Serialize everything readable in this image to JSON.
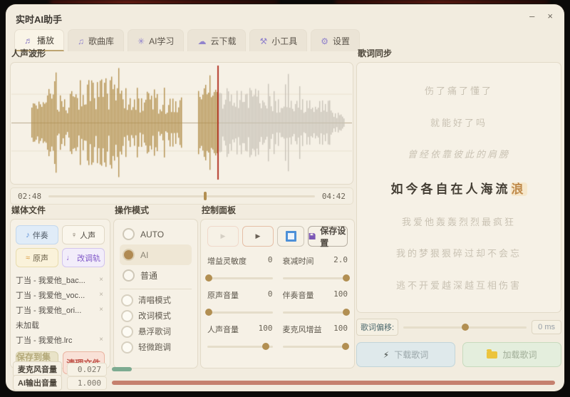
{
  "window": {
    "title": "实时AI助手",
    "minimize_label": "–",
    "close_label": "×"
  },
  "icons": {
    "piano": "♬",
    "music_notes": "♫",
    "ai": "✳",
    "cloud": "☁",
    "tools": "⚒",
    "gear": "⚙",
    "note": "♪",
    "person": "♀",
    "wave": "≈",
    "pitch": "♩",
    "play": "▶",
    "lightning": "⚡",
    "remove": "×"
  },
  "tabs": {
    "items": [
      {
        "label": "播放",
        "active": true
      },
      {
        "label": "歌曲库",
        "active": false
      },
      {
        "label": "AI学习",
        "active": false
      },
      {
        "label": "云下载",
        "active": false
      },
      {
        "label": "小工具",
        "active": false
      },
      {
        "label": "设置",
        "active": false
      }
    ]
  },
  "waveform": {
    "title": "人声波形",
    "current_time": "02:48",
    "total_time": "04:42",
    "progress_percent": 59.6,
    "cursor_percent": 60.5,
    "played_color": "#b3914f",
    "unplayed_color": "#c9c3b8",
    "cursor_color": "#b53a2a",
    "baseline_color": "#b9a98c"
  },
  "media": {
    "title": "媒体文件",
    "buttons": [
      {
        "label": "伴奏"
      },
      {
        "label": "人声"
      },
      {
        "label": "原声"
      },
      {
        "label": "改调轨"
      }
    ],
    "files": [
      {
        "name": "丁当 - 我爱他_bac...",
        "remove": "×"
      },
      {
        "name": "丁当 - 我爱他_voc...",
        "remove": "×"
      },
      {
        "name": "丁当 - 我爱他_ori...",
        "remove": "×"
      },
      {
        "name": "未加载",
        "remove": ""
      },
      {
        "name": "丁当 - 我爱他.lrc",
        "remove": "×"
      }
    ],
    "save_button": "保存到集合",
    "clean_button": "清理文件"
  },
  "mode": {
    "title": "操作模式",
    "radios": [
      {
        "label": "AUTO",
        "selected": false
      },
      {
        "label": "AI",
        "selected": true
      },
      {
        "label": "普通",
        "selected": false
      }
    ],
    "checks": [
      {
        "label": "清唱模式",
        "checked": false
      },
      {
        "label": "改词模式",
        "checked": false
      },
      {
        "label": "悬浮歌词",
        "checked": false
      },
      {
        "label": "轻微跑调",
        "checked": false
      }
    ]
  },
  "control": {
    "title": "控制面板",
    "save_button": "保存设置",
    "sliders": [
      {
        "label": "增益灵敏度",
        "value": "0",
        "percent": 2
      },
      {
        "label": "衰减时间",
        "value": "2.0",
        "percent": 98
      },
      {
        "label": "原声音量",
        "value": "0",
        "percent": 2
      },
      {
        "label": "伴奏音量",
        "value": "100",
        "percent": 98
      },
      {
        "label": "人声音量",
        "value": "100",
        "percent": 90
      },
      {
        "label": "麦克风增益",
        "value": "100",
        "percent": 97
      }
    ]
  },
  "lyrics": {
    "title": "歌词同步",
    "lines_before": [
      "伤了痛了懂了",
      "就能好了吗",
      "曾经依靠彼此的肩膀"
    ],
    "active_line": {
      "prefix": "如今各自在人海流",
      "highlight": "浪"
    },
    "lines_after": [
      "我爱他轰轰烈烈最疯狂",
      "我的梦狠狠碎过却不会忘",
      "逃不开爱越深越互相伤害"
    ],
    "offset_label": "歌词偏移:",
    "offset_value": "0 ms",
    "offset_percent": 50,
    "download_button": "下载歌词",
    "load_button": "加载歌词"
  },
  "status": {
    "mic_label": "麦克风音量",
    "mic_value": "0.027",
    "mic_percent": 4.5,
    "mic_color": "#7dab91",
    "ai_label": "AI输出音量",
    "ai_value": "1.000",
    "ai_percent": 99.5,
    "ai_color": "#c5806e"
  }
}
